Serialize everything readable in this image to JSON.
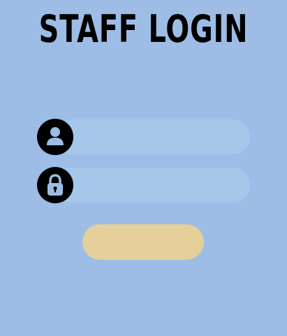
{
  "header": {
    "title": "STAFF LOGIN"
  },
  "form": {
    "username": {
      "value": "",
      "icon": "user-icon"
    },
    "password": {
      "value": "",
      "icon": "lock-icon"
    },
    "submit_label": ""
  },
  "colors": {
    "background": "#9dbde6",
    "field": "#a5c8ea",
    "icon_badge": "#000000",
    "button": "#e5cf9b",
    "title": "#000000"
  }
}
